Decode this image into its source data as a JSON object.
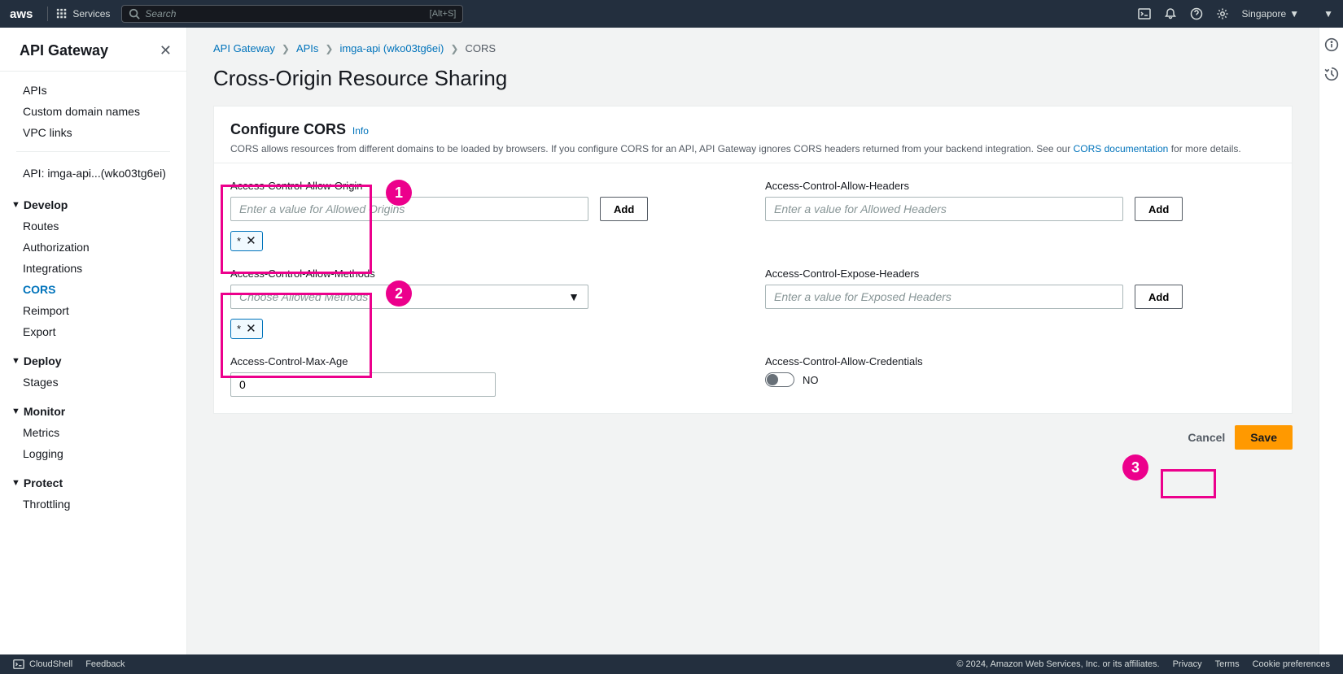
{
  "topnav": {
    "logo": "aws",
    "services_label": "Services",
    "search_placeholder": "Search",
    "search_shortcut": "[Alt+S]",
    "region": "Singapore"
  },
  "sidebar": {
    "title": "API Gateway",
    "top_links": [
      "APIs",
      "Custom domain names",
      "VPC links"
    ],
    "api_info": "API: imga-api...(wko03tg6ei)",
    "sections": [
      {
        "title": "Develop",
        "items": [
          "Routes",
          "Authorization",
          "Integrations",
          "CORS",
          "Reimport",
          "Export"
        ],
        "active": "CORS"
      },
      {
        "title": "Deploy",
        "items": [
          "Stages"
        ]
      },
      {
        "title": "Monitor",
        "items": [
          "Metrics",
          "Logging"
        ]
      },
      {
        "title": "Protect",
        "items": [
          "Throttling"
        ]
      }
    ]
  },
  "breadcrumb": [
    {
      "label": "API Gateway",
      "link": true
    },
    {
      "label": "APIs",
      "link": true
    },
    {
      "label": "imga-api (wko03tg6ei)",
      "link": true
    },
    {
      "label": "CORS",
      "link": false
    }
  ],
  "page_title": "Cross-Origin Resource Sharing",
  "panel": {
    "title": "Configure CORS",
    "info_label": "Info",
    "description_pre": "CORS allows resources from different domains to be loaded by browsers. If you configure CORS for an API, API Gateway ignores CORS headers returned from your backend integration. See our ",
    "doc_link": "CORS documentation",
    "description_post": " for more details."
  },
  "form": {
    "allow_origin": {
      "label": "Access-Control-Allow-Origin",
      "placeholder": "Enter a value for Allowed Origins",
      "add_button": "Add",
      "chip": "*"
    },
    "allow_headers": {
      "label": "Access-Control-Allow-Headers",
      "placeholder": "Enter a value for Allowed Headers",
      "add_button": "Add"
    },
    "allow_methods": {
      "label": "Access-Control-Allow-Methods",
      "placeholder": "Choose Allowed Methods",
      "chip": "*"
    },
    "expose_headers": {
      "label": "Access-Control-Expose-Headers",
      "placeholder": "Enter a value for Exposed Headers",
      "add_button": "Add"
    },
    "max_age": {
      "label": "Access-Control-Max-Age",
      "value": "0"
    },
    "allow_credentials": {
      "label": "Access-Control-Allow-Credentials",
      "value": "NO"
    }
  },
  "actions": {
    "cancel": "Cancel",
    "save": "Save"
  },
  "footer": {
    "cloudshell": "CloudShell",
    "feedback": "Feedback",
    "copyright": "© 2024, Amazon Web Services, Inc. or its affiliates.",
    "links": [
      "Privacy",
      "Terms",
      "Cookie preferences"
    ]
  },
  "callouts": [
    "1",
    "2",
    "3"
  ]
}
